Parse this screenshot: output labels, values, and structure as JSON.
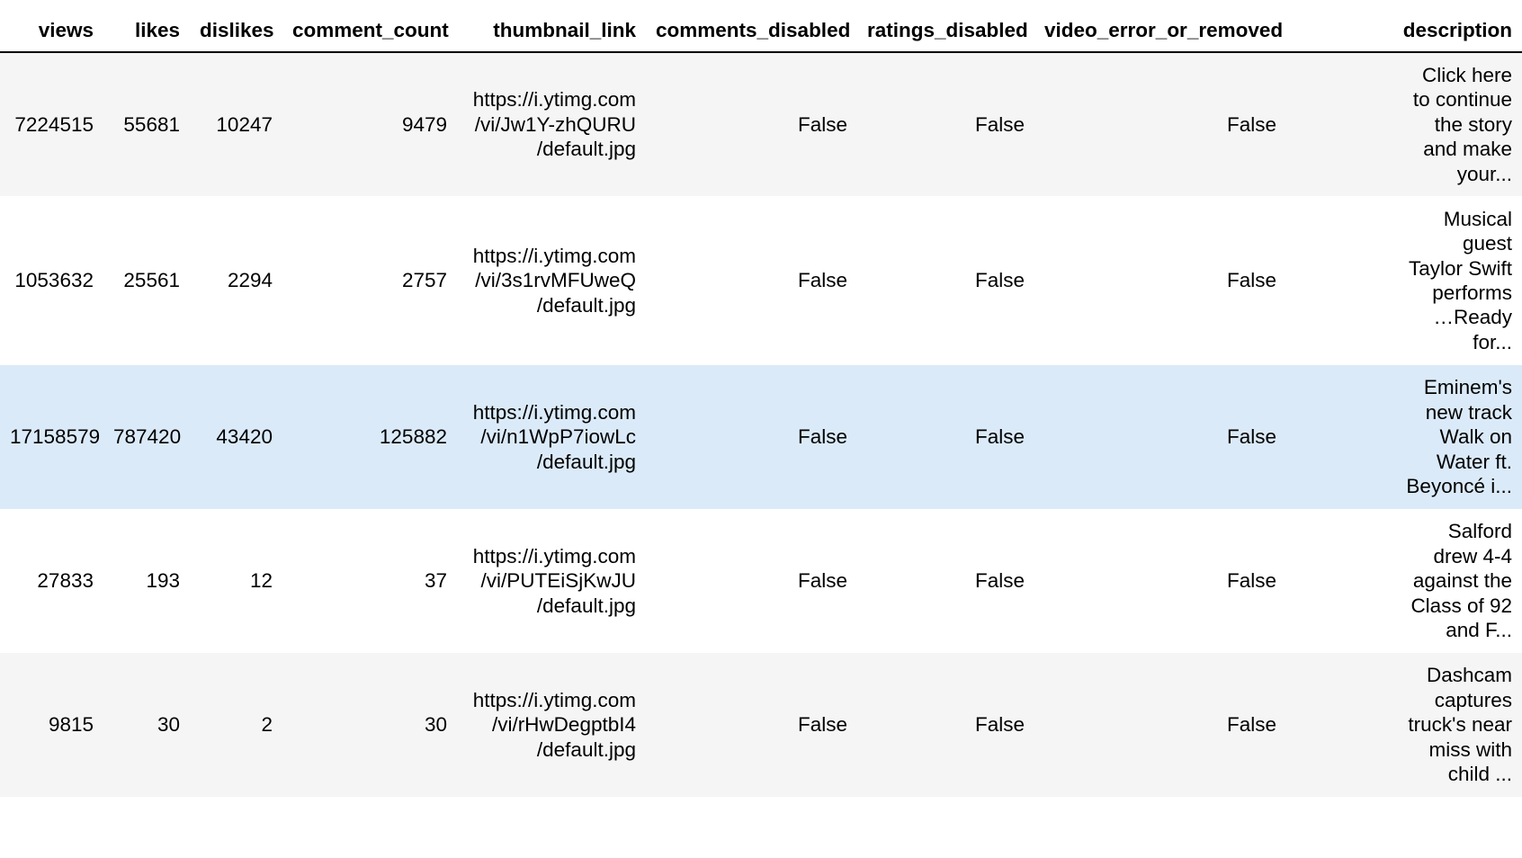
{
  "table": {
    "columns": [
      "views",
      "likes",
      "dislikes",
      "comment_count",
      "thumbnail_link",
      "comments_disabled",
      "ratings_disabled",
      "video_error_or_removed",
      "description"
    ],
    "rows": [
      {
        "views": "7224515",
        "likes": "55681",
        "dislikes": "10247",
        "comment_count": "9479",
        "thumbnail_link": [
          "https://i.ytimg.com",
          "/vi/Jw1Y-zhQURU",
          "/default.jpg"
        ],
        "comments_disabled": "False",
        "ratings_disabled": "False",
        "video_error_or_removed": "False",
        "description": [
          "Click here",
          "to continue",
          "the story",
          "and make",
          "your..."
        ],
        "highlighted": false
      },
      {
        "views": "1053632",
        "likes": "25561",
        "dislikes": "2294",
        "comment_count": "2757",
        "thumbnail_link": [
          "https://i.ytimg.com",
          "/vi/3s1rvMFUweQ",
          "/default.jpg"
        ],
        "comments_disabled": "False",
        "ratings_disabled": "False",
        "video_error_or_removed": "False",
        "description": [
          "Musical",
          "guest",
          "Taylor Swift",
          "performs",
          "…Ready",
          "for..."
        ],
        "highlighted": false
      },
      {
        "views": "17158579",
        "likes": "787420",
        "dislikes": "43420",
        "comment_count": "125882",
        "thumbnail_link": [
          "https://i.ytimg.com",
          "/vi/n1WpP7iowLc",
          "/default.jpg"
        ],
        "comments_disabled": "False",
        "ratings_disabled": "False",
        "video_error_or_removed": "False",
        "description": [
          "Eminem's",
          "new track",
          "Walk on",
          "Water ft.",
          "Beyoncé i..."
        ],
        "highlighted": true
      },
      {
        "views": "27833",
        "likes": "193",
        "dislikes": "12",
        "comment_count": "37",
        "thumbnail_link": [
          "https://i.ytimg.com",
          "/vi/PUTEiSjKwJU",
          "/default.jpg"
        ],
        "comments_disabled": "False",
        "ratings_disabled": "False",
        "video_error_or_removed": "False",
        "description": [
          "Salford",
          "drew 4-4",
          "against the",
          "Class of 92",
          "and F..."
        ],
        "highlighted": false
      },
      {
        "views": "9815",
        "likes": "30",
        "dislikes": "2",
        "comment_count": "30",
        "thumbnail_link": [
          "https://i.ytimg.com",
          "/vi/rHwDegptbI4",
          "/default.jpg"
        ],
        "comments_disabled": "False",
        "ratings_disabled": "False",
        "video_error_or_removed": "False",
        "description": [
          "Dashcam",
          "captures",
          "truck's near",
          "miss with",
          "child ..."
        ],
        "highlighted": false
      }
    ]
  },
  "colors": {
    "row_odd": "#f5f5f5",
    "row_even": "#ffffff",
    "row_highlight": "#dbeaf8",
    "header_rule": "#000000"
  }
}
